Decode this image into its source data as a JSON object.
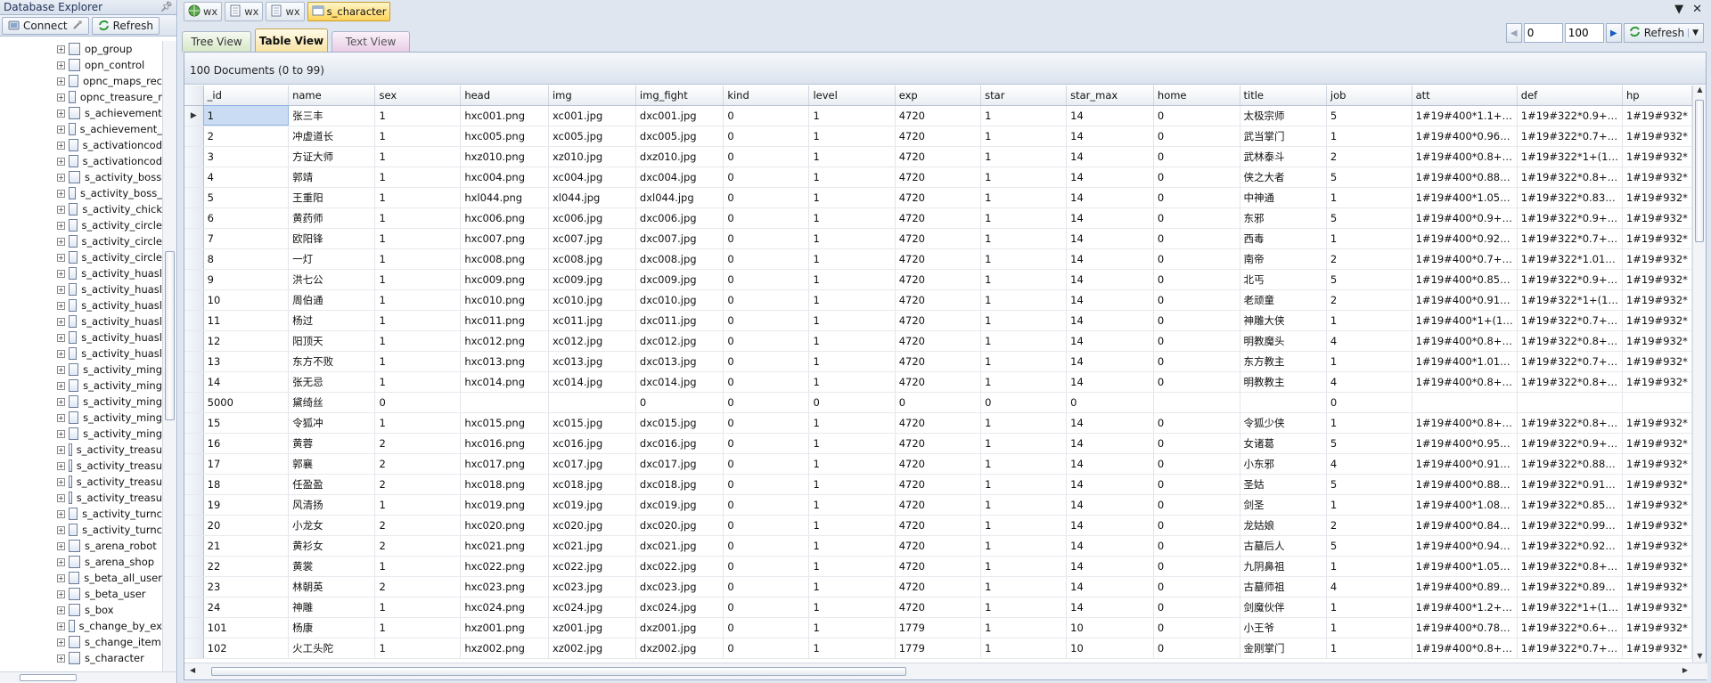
{
  "explorer": {
    "title": "Database Explorer",
    "pin_icon": "pin-icon",
    "connect_label": "Connect",
    "refresh_label": "Refresh",
    "tree_items": [
      "op_group",
      "opn_control",
      "opnc_maps_rec",
      "opnc_treasure_r",
      "s_achievement",
      "s_achievement_",
      "s_activationcod",
      "s_activationcod",
      "s_activity_boss",
      "s_activity_boss_",
      "s_activity_chick",
      "s_activity_circle",
      "s_activity_circle",
      "s_activity_circle",
      "s_activity_huasl",
      "s_activity_huasl",
      "s_activity_huasl",
      "s_activity_huasl",
      "s_activity_huasl",
      "s_activity_huasl",
      "s_activity_ming",
      "s_activity_ming",
      "s_activity_ming",
      "s_activity_ming",
      "s_activity_ming",
      "s_activity_treasu",
      "s_activity_treasu",
      "s_activity_treasu",
      "s_activity_treasu",
      "s_activity_turnc",
      "s_activity_turnc",
      "s_arena_robot",
      "s_arena_shop",
      "s_beta_all_user",
      "s_beta_user",
      "s_box",
      "s_change_by_ex",
      "s_change_item",
      "s_character"
    ]
  },
  "doc_tabs": [
    {
      "label": "wx",
      "icon": "globe-icon",
      "active": false
    },
    {
      "label": "wx",
      "icon": "database-icon",
      "active": false
    },
    {
      "label": "wx",
      "icon": "database-icon",
      "active": false
    },
    {
      "label": "s_character",
      "icon": "collection-icon",
      "active": true
    }
  ],
  "view_tabs": {
    "tree": "Tree View",
    "table": "Table View",
    "text": "Text View"
  },
  "pager": {
    "skip": "0",
    "limit": "100",
    "refresh_label": "Refresh"
  },
  "summary": "100 Documents (0 to 99)",
  "table": {
    "columns": [
      "_id",
      "name",
      "sex",
      "head",
      "img",
      "img_fight",
      "kind",
      "level",
      "exp",
      "star",
      "star_max",
      "home",
      "title",
      "job",
      "att",
      "def",
      "hp"
    ],
    "rows": [
      [
        "1",
        "张三丰",
        "1",
        "hxc001.png",
        "xc001.jpg",
        "dxc001.jpg",
        "0",
        "1",
        "4720",
        "1",
        "14",
        "0",
        "太极宗师",
        "5",
        "1#19#400*1.1+…",
        "1#19#322*0.9+…",
        "1#19#932*"
      ],
      [
        "2",
        "冲虚道长",
        "1",
        "hxc005.png",
        "xc005.jpg",
        "dxc005.jpg",
        "0",
        "1",
        "4720",
        "1",
        "14",
        "0",
        "武当掌门",
        "1",
        "1#19#400*0.96…",
        "1#19#322*0.7+…",
        "1#19#932*"
      ],
      [
        "3",
        "方证大师",
        "1",
        "hxz010.png",
        "xz010.jpg",
        "dxz010.jpg",
        "0",
        "1",
        "4720",
        "1",
        "14",
        "0",
        "武林泰斗",
        "2",
        "1#19#400*0.8+…",
        "1#19#322*1+(1…",
        "1#19#932*"
      ],
      [
        "4",
        "郭靖",
        "1",
        "hxc004.png",
        "xc004.jpg",
        "dxc004.jpg",
        "0",
        "1",
        "4720",
        "1",
        "14",
        "0",
        "侠之大者",
        "5",
        "1#19#400*0.88…",
        "1#19#322*0.8+…",
        "1#19#932*"
      ],
      [
        "5",
        "王重阳",
        "1",
        "hxl044.png",
        "xl044.jpg",
        "dxl044.jpg",
        "0",
        "1",
        "4720",
        "1",
        "14",
        "0",
        "中神通",
        "1",
        "1#19#400*1.05…",
        "1#19#322*0.83…",
        "1#19#932*"
      ],
      [
        "6",
        "黄药师",
        "1",
        "hxc006.png",
        "xc006.jpg",
        "dxc006.jpg",
        "0",
        "1",
        "4720",
        "1",
        "14",
        "0",
        "东邪",
        "5",
        "1#19#400*0.9+…",
        "1#19#322*0.9+…",
        "1#19#932*"
      ],
      [
        "7",
        "欧阳锋",
        "1",
        "hxc007.png",
        "xc007.jpg",
        "dxc007.jpg",
        "0",
        "1",
        "4720",
        "1",
        "14",
        "0",
        "西毒",
        "1",
        "1#19#400*0.92…",
        "1#19#322*0.7+…",
        "1#19#932*"
      ],
      [
        "8",
        "一灯",
        "1",
        "hxc008.png",
        "xc008.jpg",
        "dxc008.jpg",
        "0",
        "1",
        "4720",
        "1",
        "14",
        "0",
        "南帝",
        "2",
        "1#19#400*0.7+…",
        "1#19#322*1.01…",
        "1#19#932*"
      ],
      [
        "9",
        "洪七公",
        "1",
        "hxc009.png",
        "xc009.jpg",
        "dxc009.jpg",
        "0",
        "1",
        "4720",
        "1",
        "14",
        "0",
        "北丐",
        "5",
        "1#19#400*0.85…",
        "1#19#322*0.9+…",
        "1#19#932*"
      ],
      [
        "10",
        "周伯通",
        "1",
        "hxc010.png",
        "xc010.jpg",
        "dxc010.jpg",
        "0",
        "1",
        "4720",
        "1",
        "14",
        "0",
        "老顽童",
        "2",
        "1#19#400*0.91…",
        "1#19#322*1+(1…",
        "1#19#932*"
      ],
      [
        "11",
        "杨过",
        "1",
        "hxc011.png",
        "xc011.jpg",
        "dxc011.jpg",
        "0",
        "1",
        "4720",
        "1",
        "14",
        "0",
        "神雕大侠",
        "1",
        "1#19#400*1+(1…",
        "1#19#322*0.7+…",
        "1#19#932*"
      ],
      [
        "12",
        "阳顶天",
        "1",
        "hxc012.png",
        "xc012.jpg",
        "dxc012.jpg",
        "0",
        "1",
        "4720",
        "1",
        "14",
        "0",
        "明教魔头",
        "4",
        "1#19#400*0.8+…",
        "1#19#322*0.8+…",
        "1#19#932*"
      ],
      [
        "13",
        "东方不败",
        "1",
        "hxc013.png",
        "xc013.jpg",
        "dxc013.jpg",
        "0",
        "1",
        "4720",
        "1",
        "14",
        "0",
        "东方教主",
        "1",
        "1#19#400*1.01…",
        "1#19#322*0.7+…",
        "1#19#932*"
      ],
      [
        "14",
        "张无忌",
        "1",
        "hxc014.png",
        "xc014.jpg",
        "dxc014.jpg",
        "0",
        "1",
        "4720",
        "1",
        "14",
        "0",
        "明教教主",
        "4",
        "1#19#400*0.8+…",
        "1#19#322*0.8+…",
        "1#19#932*"
      ],
      [
        "5000",
        "黛绮丝",
        "0",
        "",
        "",
        "0",
        "0",
        "0",
        "0",
        "0",
        "0",
        "",
        "",
        "0",
        "",
        "",
        ""
      ],
      [
        "15",
        "令狐冲",
        "1",
        "hxc015.png",
        "xc015.jpg",
        "dxc015.jpg",
        "0",
        "1",
        "4720",
        "1",
        "14",
        "0",
        "令狐少侠",
        "1",
        "1#19#400*0.8+…",
        "1#19#322*0.8+…",
        "1#19#932*"
      ],
      [
        "16",
        "黄蓉",
        "2",
        "hxc016.png",
        "xc016.jpg",
        "dxc016.jpg",
        "0",
        "1",
        "4720",
        "1",
        "14",
        "0",
        "女诸葛",
        "5",
        "1#19#400*0.95…",
        "1#19#322*0.9+…",
        "1#19#932*"
      ],
      [
        "17",
        "郭襄",
        "2",
        "hxc017.png",
        "xc017.jpg",
        "dxc017.jpg",
        "0",
        "1",
        "4720",
        "1",
        "14",
        "0",
        "小东邪",
        "4",
        "1#19#400*0.91…",
        "1#19#322*0.88…",
        "1#19#932*"
      ],
      [
        "18",
        "任盈盈",
        "2",
        "hxc018.png",
        "xc018.jpg",
        "dxc018.jpg",
        "0",
        "1",
        "4720",
        "1",
        "14",
        "0",
        "圣姑",
        "5",
        "1#19#400*0.88…",
        "1#19#322*0.91…",
        "1#19#932*"
      ],
      [
        "19",
        "风清扬",
        "1",
        "hxc019.png",
        "xc019.jpg",
        "dxc019.jpg",
        "0",
        "1",
        "4720",
        "1",
        "14",
        "0",
        "剑圣",
        "1",
        "1#19#400*1.08…",
        "1#19#322*0.85…",
        "1#19#932*"
      ],
      [
        "20",
        "小龙女",
        "2",
        "hxc020.png",
        "xc020.jpg",
        "dxc020.jpg",
        "0",
        "1",
        "4720",
        "1",
        "14",
        "0",
        "龙姑娘",
        "2",
        "1#19#400*0.84…",
        "1#19#322*0.99…",
        "1#19#932*"
      ],
      [
        "21",
        "黄衫女",
        "2",
        "hxc021.png",
        "xc021.jpg",
        "dxc021.jpg",
        "0",
        "1",
        "4720",
        "1",
        "14",
        "0",
        "古墓后人",
        "5",
        "1#19#400*0.94…",
        "1#19#322*0.92…",
        "1#19#932*"
      ],
      [
        "22",
        "黄裳",
        "1",
        "hxc022.png",
        "xc022.jpg",
        "dxc022.jpg",
        "0",
        "1",
        "4720",
        "1",
        "14",
        "0",
        "九阴鼻祖",
        "1",
        "1#19#400*1.05…",
        "1#19#322*0.8+…",
        "1#19#932*"
      ],
      [
        "23",
        "林朝英",
        "2",
        "hxc023.png",
        "xc023.jpg",
        "dxc023.jpg",
        "0",
        "1",
        "4720",
        "1",
        "14",
        "0",
        "古墓师祖",
        "4",
        "1#19#400*0.89…",
        "1#19#322*0.89…",
        "1#19#932*"
      ],
      [
        "24",
        "神雕",
        "1",
        "hxc024.png",
        "xc024.jpg",
        "dxc024.jpg",
        "0",
        "1",
        "4720",
        "1",
        "14",
        "0",
        "剑魔伙伴",
        "1",
        "1#19#400*1.2+…",
        "1#19#322*1+(1…",
        "1#19#932*"
      ],
      [
        "101",
        "杨康",
        "1",
        "hxz001.png",
        "xz001.jpg",
        "dxz001.jpg",
        "0",
        "1",
        "1779",
        "1",
        "10",
        "0",
        "小王爷",
        "1",
        "1#19#400*0.78…",
        "1#19#322*0.6+…",
        "1#19#932*"
      ],
      [
        "102",
        "火工头陀",
        "1",
        "hxz002.png",
        "xz002.jpg",
        "dxz002.jpg",
        "0",
        "1",
        "1779",
        "1",
        "10",
        "0",
        "金刚掌门",
        "1",
        "1#19#400*0.8+…",
        "1#19#322*0.7+…",
        "1#19#932*"
      ]
    ],
    "selected_row": 0
  },
  "colors": {
    "accent": "#ffd35a",
    "selection": "#c9dcf4",
    "border": "#9db2cd"
  }
}
